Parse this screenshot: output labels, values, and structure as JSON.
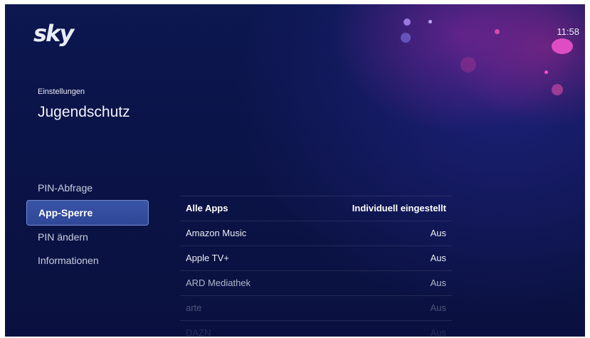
{
  "brand": {
    "logo": "sky"
  },
  "status": {
    "time": "11:58"
  },
  "header": {
    "breadcrumb": "Einstellungen",
    "title": "Jugendschutz"
  },
  "sidebar": {
    "items": [
      {
        "label": "PIN-Abfrage",
        "selected": false
      },
      {
        "label": "App-Sperre",
        "selected": true
      },
      {
        "label": "PIN ändern",
        "selected": false
      },
      {
        "label": "Informationen",
        "selected": false
      }
    ]
  },
  "apps_table": {
    "header": {
      "name": "Alle Apps",
      "value": "Individuell eingestellt"
    },
    "rows": [
      {
        "name": "Amazon Music",
        "value": "Aus"
      },
      {
        "name": "Apple TV+",
        "value": "Aus"
      },
      {
        "name": "ARD Mediathek",
        "value": "Aus"
      },
      {
        "name": "arte",
        "value": "Aus"
      },
      {
        "name": "DAZN",
        "value": "Aus"
      }
    ]
  },
  "colors": {
    "background": "#0b1448",
    "selected": "#3a54a8",
    "accent": "#c02aa0"
  }
}
